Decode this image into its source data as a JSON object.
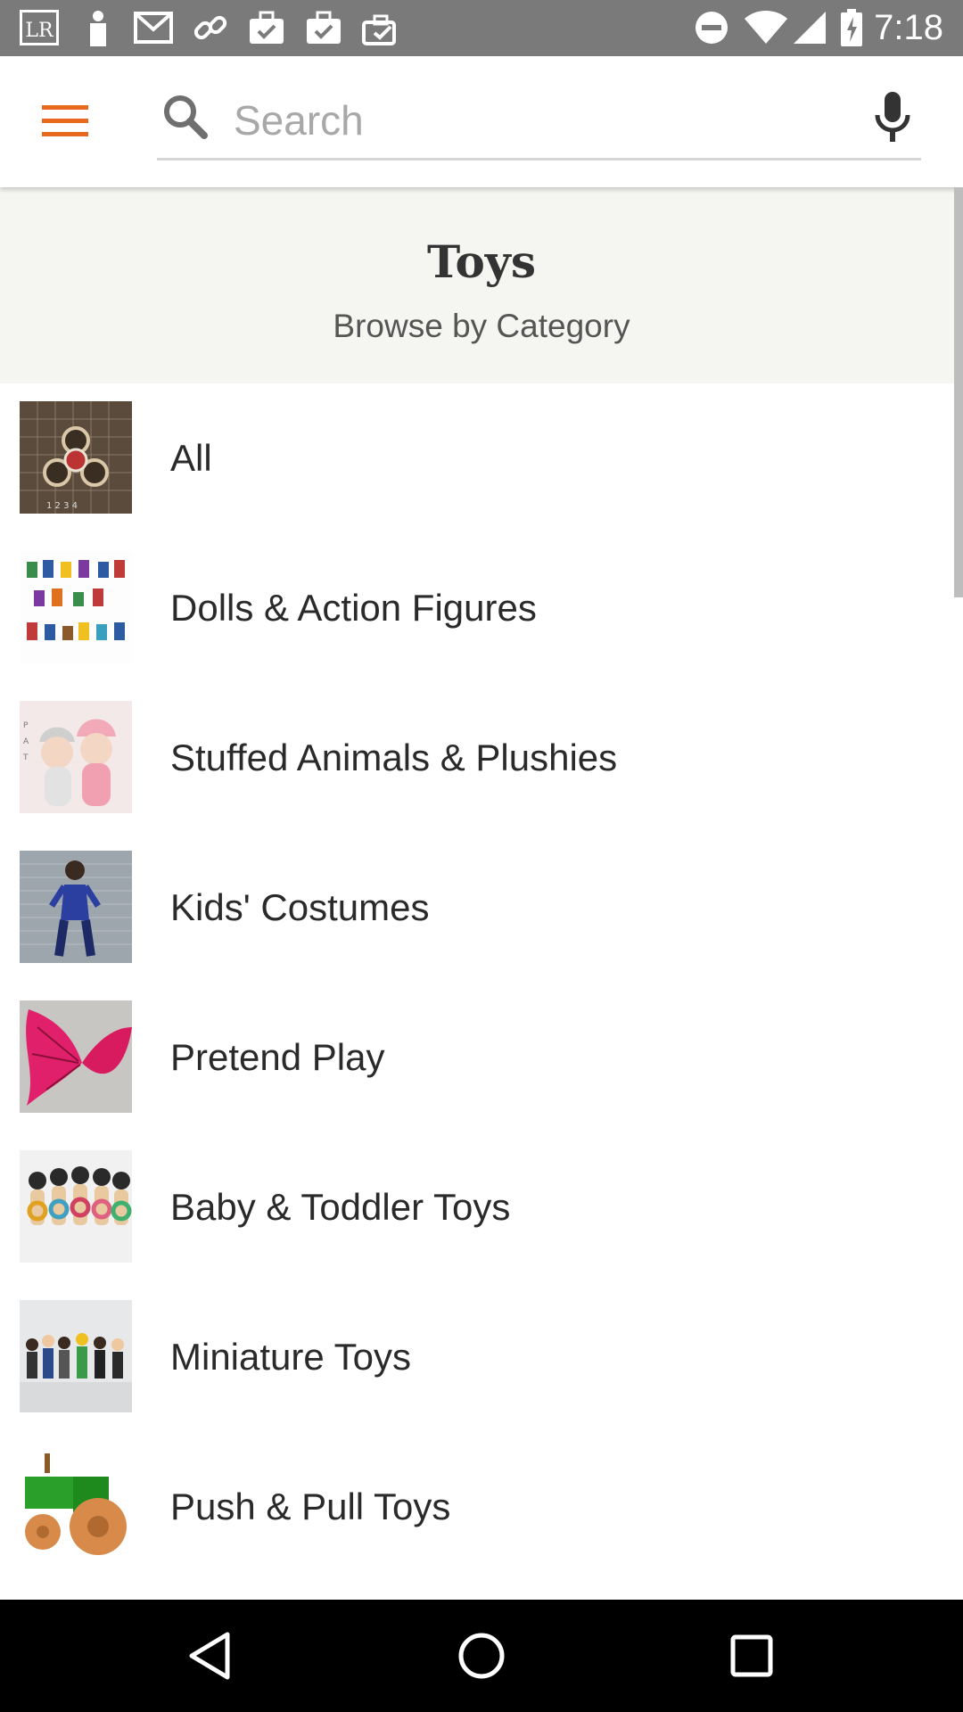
{
  "status_bar": {
    "time": "7:18",
    "left_icons": [
      "lr-app-icon",
      "person-icon",
      "gmail-icon",
      "link-icon",
      "briefcase-check-icon",
      "briefcase-check-icon",
      "briefcase-check-icon"
    ],
    "right_icons": [
      "do-not-disturb-icon",
      "wifi-icon",
      "signal-icon",
      "battery-charging-icon"
    ]
  },
  "search": {
    "placeholder": "Search"
  },
  "header": {
    "title": "Toys",
    "subtitle": "Browse by Category"
  },
  "categories": [
    {
      "label": "All"
    },
    {
      "label": "Dolls & Action Figures"
    },
    {
      "label": "Stuffed Animals & Plushies"
    },
    {
      "label": "Kids' Costumes"
    },
    {
      "label": "Pretend Play"
    },
    {
      "label": "Baby & Toddler Toys"
    },
    {
      "label": "Miniature Toys"
    },
    {
      "label": "Push & Pull Toys"
    }
  ],
  "colors": {
    "accent": "#e8691e",
    "header_bg": "#f5f5f1",
    "status_bar": "#7a7a7a"
  }
}
